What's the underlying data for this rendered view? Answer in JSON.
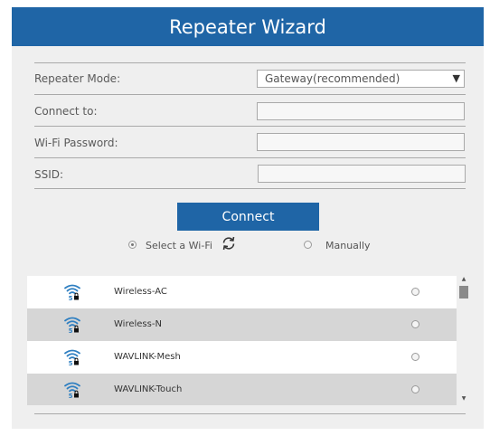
{
  "header": {
    "title": "Repeater Wizard"
  },
  "form": {
    "mode_label": "Repeater Mode:",
    "mode_value": "Gateway(recommended)",
    "connect_to_label": "Connect to:",
    "connect_to_value": "",
    "password_label": "Wi-Fi Password:",
    "password_value": "",
    "ssid_label": "SSID:",
    "ssid_value": ""
  },
  "connect_button": {
    "label": "Connect"
  },
  "options": {
    "select_wifi_label": "Select a Wi-Fi",
    "select_wifi_checked": true,
    "manually_label": "Manually",
    "manually_checked": false
  },
  "networks": [
    {
      "name": "Wireless-AC",
      "band": "5",
      "icon": "wifi-5ghz-lock-icon"
    },
    {
      "name": "Wireless-N",
      "band": "5",
      "icon": "wifi-5ghz-lock-icon"
    },
    {
      "name": "WAVLINK-Mesh",
      "band": "5",
      "icon": "wifi-5ghz-lock-icon"
    },
    {
      "name": "WAVLINK-Touch",
      "band": "5",
      "icon": "wifi-5ghz-lock-icon"
    }
  ],
  "colors": {
    "brand_blue": "#1f65a6",
    "panel_bg": "#efefef",
    "row_alt_bg": "#d6d6d6",
    "wifi_icon_blue": "#2f7fc1"
  }
}
